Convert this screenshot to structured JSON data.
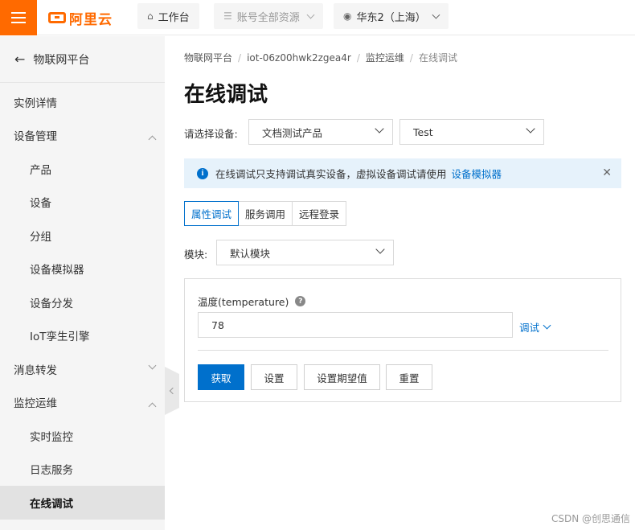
{
  "topbar": {
    "logo_text": "阿里云",
    "workbench": "工作台",
    "resources": "账号全部资源",
    "region": "华东2（上海）"
  },
  "sidebar": {
    "back_label": "物联网平台",
    "items": [
      {
        "label": "实例详情",
        "level": 1
      },
      {
        "label": "设备管理",
        "level": 1,
        "expanded": true
      },
      {
        "label": "产品",
        "level": 2
      },
      {
        "label": "设备",
        "level": 2
      },
      {
        "label": "分组",
        "level": 2
      },
      {
        "label": "设备模拟器",
        "level": 2
      },
      {
        "label": "设备分发",
        "level": 2
      },
      {
        "label": "IoT孪生引擎",
        "level": 2
      },
      {
        "label": "消息转发",
        "level": 1,
        "expanded": false
      },
      {
        "label": "监控运维",
        "level": 1,
        "expanded": true
      },
      {
        "label": "实时监控",
        "level": 2
      },
      {
        "label": "日志服务",
        "level": 2
      },
      {
        "label": "在线调试",
        "level": 2,
        "active": true
      }
    ]
  },
  "breadcrumb": [
    "物联网平台",
    "iot-06z00hwk2zgea4r",
    "监控运维",
    "在线调试"
  ],
  "page_title": "在线调试",
  "device_select": {
    "label": "请选择设备:",
    "product": "文档测试产品",
    "device": "Test"
  },
  "notice": {
    "text": "在线调试只支持调试真实设备，虚拟设备调试请使用",
    "link": "设备模拟器"
  },
  "tabs": [
    "属性调试",
    "服务调用",
    "远程登录"
  ],
  "active_tab": 0,
  "module": {
    "label": "模块:",
    "value": "默认模块"
  },
  "property": {
    "label": "温度(temperature)",
    "value": "78",
    "debug_label": "调试"
  },
  "buttons": {
    "get": "获取",
    "set": "设置",
    "set_expected": "设置期望值",
    "reset": "重置"
  },
  "watermark": "CSDN @创思通信",
  "colors": {
    "brand": "#ff6a00",
    "primary": "#0070cc",
    "notice_bg": "#e6f2fb"
  }
}
